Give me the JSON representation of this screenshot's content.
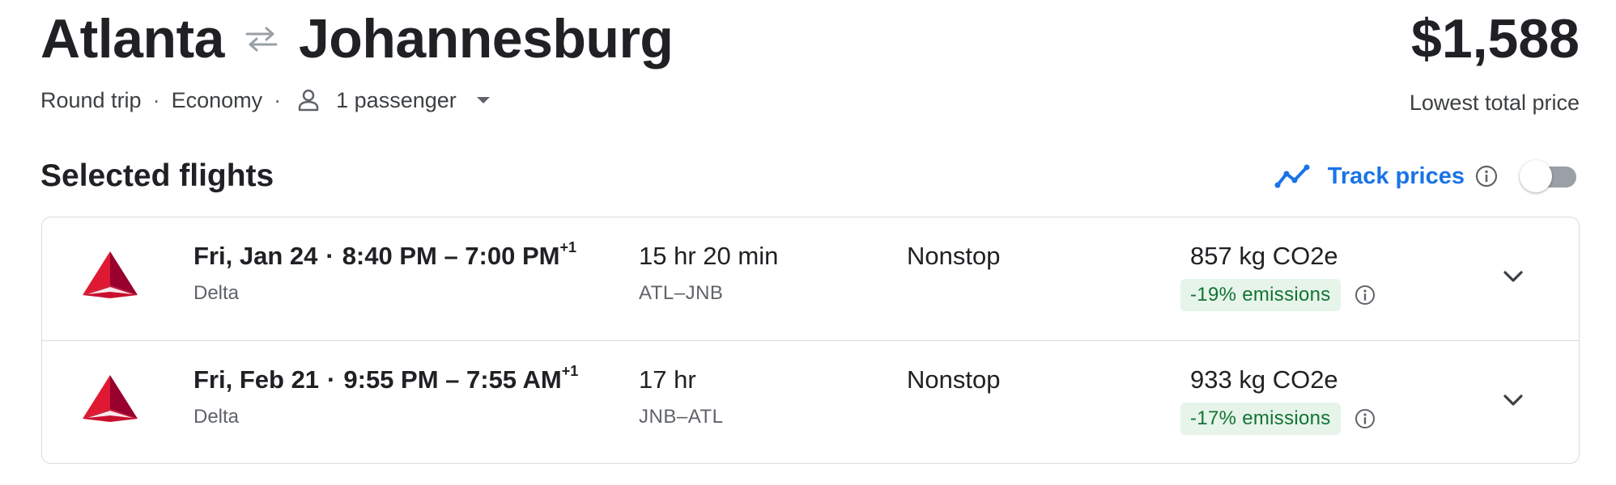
{
  "header": {
    "origin": "Atlanta",
    "destination": "Johannesburg",
    "price": "$1,588",
    "price_label": "Lowest total price",
    "trip_type": "Round trip",
    "separator": "·",
    "cabin": "Economy",
    "passengers": "1 passenger"
  },
  "section": {
    "title": "Selected flights",
    "track_label": "Track prices",
    "track_enabled": false
  },
  "flights": [
    {
      "date": "Fri, Jan 24",
      "separator": "·",
      "times": "8:40 PM – 7:00 PM",
      "day_offset": "+1",
      "airline": "Delta",
      "duration": "15 hr 20 min",
      "route": "ATL–JNB",
      "stops": "Nonstop",
      "emissions": "857 kg CO2e",
      "emissions_badge": "-19% emissions"
    },
    {
      "date": "Fri, Feb 21",
      "separator": "·",
      "times": "9:55 PM – 7:55 AM",
      "day_offset": "+1",
      "airline": "Delta",
      "duration": "17 hr",
      "route": "JNB–ATL",
      "stops": "Nonstop",
      "emissions": "933 kg CO2e",
      "emissions_badge": "-17% emissions"
    }
  ],
  "colors": {
    "accent": "#1a73e8",
    "badge_bg": "#e6f4ea",
    "badge_text": "#137333",
    "delta_red": "#c8102e"
  },
  "icons": {
    "swap": "swap-arrows-icon",
    "person": "person-icon",
    "dropdown": "caret-down-icon",
    "trend": "trend-line-icon",
    "info": "info-icon",
    "expand": "chevron-down-icon",
    "airline_logo": "delta-logo-icon"
  }
}
